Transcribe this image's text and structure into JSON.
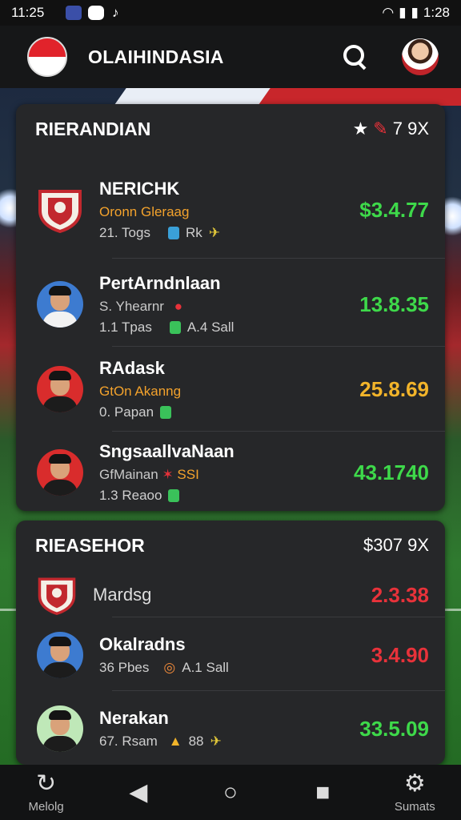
{
  "status": {
    "time": "11:25",
    "right_time": "1:28"
  },
  "app": {
    "title": "OLAIHINDASIA"
  },
  "card1": {
    "title": "RIERANDIAN",
    "meta": "7 9X",
    "rows": [
      {
        "name": "NERICHK",
        "sub": "Oronn Gleraag",
        "meta": "21. Togs",
        "meta2": "Rk",
        "value": "$3.4.77",
        "value_color": "#3ed94a"
      },
      {
        "name": "PertArndnlaan",
        "sub": "S. Yhearnr",
        "meta": "1.1 Tpas",
        "meta2": "A.4 Sall",
        "value": "13.8.35",
        "value_color": "#3ed94a"
      },
      {
        "name": "RAdask",
        "sub": "GtOn Akanng",
        "meta": "0. Papan",
        "meta2": "",
        "value": "25.8.69",
        "value_color": "#f2b42a"
      },
      {
        "name": "SngsaallvaNaan",
        "sub": "GfMainan",
        "sub2": "SSI",
        "meta": "1.3 Reaoo",
        "meta2": "",
        "value": "43.1740",
        "value_color": "#3ed94a"
      }
    ]
  },
  "card2": {
    "title": "RIEASEHOR",
    "meta": "$307 9X",
    "rows": [
      {
        "name": "Mardsg",
        "value": "2.3.38",
        "value_color": "#e8323a"
      },
      {
        "name": "Okalradns",
        "meta": "36 Pbes",
        "meta2": "A.1 Sall",
        "value": "3.4.90",
        "value_color": "#e8323a"
      },
      {
        "name": "Nerakan",
        "meta": "67. Rsam",
        "meta2": "88",
        "value": "33.5.09",
        "value_color": "#e8323a"
      }
    ]
  },
  "nav": {
    "left_label": "Melolg",
    "right_label": "Sumats"
  }
}
